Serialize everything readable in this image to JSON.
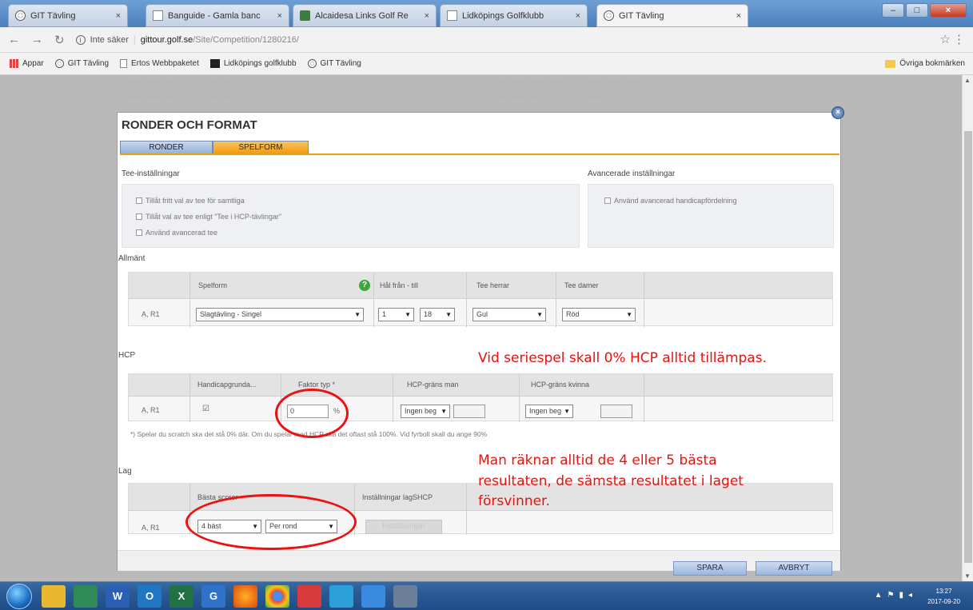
{
  "browser": {
    "tabs": [
      {
        "label": "GIT Tävling"
      },
      {
        "label": "Banguide - Gamla banc"
      },
      {
        "label": "Alcaidesa Links Golf Re"
      },
      {
        "label": "Lidköpings Golfklubb"
      },
      {
        "label": "GIT Tävling"
      }
    ],
    "address": {
      "prefix": "Inte säker",
      "host": "gittour.golf.se",
      "path": "/Site/Competition/1280216/"
    },
    "bookmarks": [
      {
        "label": "Appar"
      },
      {
        "label": "GIT Tävling"
      },
      {
        "label": "Ertos Webbpaketet"
      },
      {
        "label": "Lidköpings golfklubb"
      },
      {
        "label": "GIT Tävling"
      }
    ],
    "other_bookmarks": "Övriga bokmärken"
  },
  "dialog": {
    "title": "RONDER OCH FORMAT",
    "tabs": [
      "RONDER",
      "SPELFORM"
    ],
    "tee": {
      "heading": "Tee-inställningar",
      "options": [
        "Tillåt fritt val av tee för samtliga",
        "Tillåt val av tee enligt \"Tee i HCP-tävlingar\"",
        "Använd avancerad tee"
      ]
    },
    "advanced": {
      "heading": "Avancerade inställningar",
      "option": "Använd avancerad handicapfördelning"
    },
    "general": {
      "heading": "Allmänt",
      "headers": [
        "Spelform",
        "Hål från - till",
        "Tee herrar",
        "Tee damer"
      ],
      "row_label": "A, R1",
      "spelform": "Slagtävling - Singel",
      "hole_from": "1",
      "hole_to": "18",
      "tee_men": "Gul",
      "tee_women": "Röd"
    },
    "hcp": {
      "heading": "HCP",
      "headers": [
        "Handicapgrunda...",
        "Faktor typ *",
        "HCP-gräns man",
        "HCP-gräns kvinna"
      ],
      "row_label": "A, R1",
      "factor": "0",
      "unit": "%",
      "limit_men": "Ingen beg",
      "limit_women": "Ingen beg",
      "note": "*) Spelar du scratch ska det stå 0% där. Om du spelar med HCP ska det oftast stå 100%. Vid fyrboll skall du ange 90%"
    },
    "team": {
      "heading": "Lag",
      "headers": [
        "Bästa scorer",
        "Inställningar lagSHCP"
      ],
      "row_label": "A, R1",
      "best": "4 bäst",
      "per": "Per rond",
      "settings_button": "Inställningar"
    },
    "buttons": {
      "save": "SPARA",
      "cancel": "AVBRYT"
    }
  },
  "annotations": {
    "hcp_note": "Vid seriespel skall 0% HCP alltid tillämpas.",
    "team_note_lines": [
      "Man räknar alltid de 4 eller 5 bästa",
      "resultaten, de sämsta resultatet i laget",
      "försvinner."
    ]
  },
  "taskbar": {
    "apps": [
      "W",
      "O",
      "X",
      "G"
    ],
    "clock_time": "13:27",
    "clock_date": "2017-09-20"
  },
  "colors": {
    "accent_orange": "#f29a10",
    "annotation_red": "#e8120e",
    "tab_blue": "#95b2da"
  }
}
